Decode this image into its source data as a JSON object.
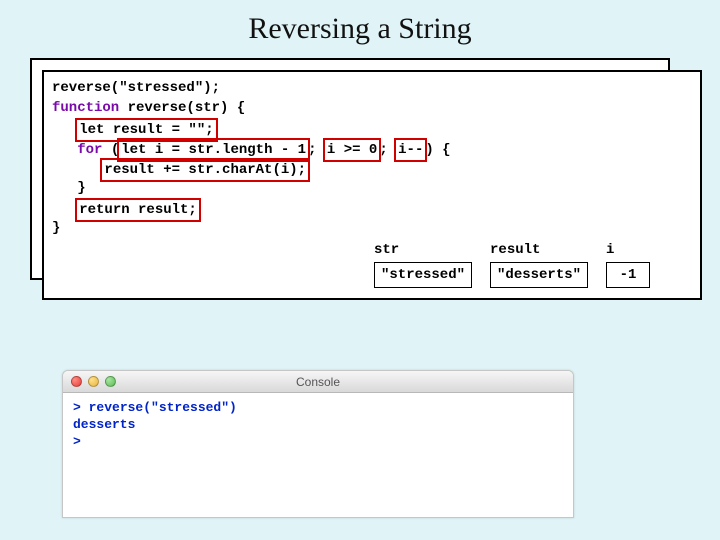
{
  "title": "Reversing a String",
  "code": {
    "call": "reverse(\"stressed\");",
    "kw_function": "function",
    "fn_sig": " reverse(str) {",
    "let_result": "let result = \"\";",
    "kw_for": "for",
    "for_init": "let i = str.length - 1",
    "for_cond": "i >= 0",
    "for_step": "i--",
    "body_line": "result += str.charAt(i);",
    "return_line": "return result;",
    "brace_close": "}",
    "brace_close2": "}"
  },
  "vars": {
    "str_label": "str",
    "str_value": "\"stressed\"",
    "result_label": "result",
    "result_value": "\"desserts\"",
    "i_label": "i",
    "i_value": "-1"
  },
  "console": {
    "title": "Console",
    "line1_prefix": "> ",
    "line1_call": "reverse(\"stressed\")",
    "line2": "desserts",
    "line3": ">"
  }
}
